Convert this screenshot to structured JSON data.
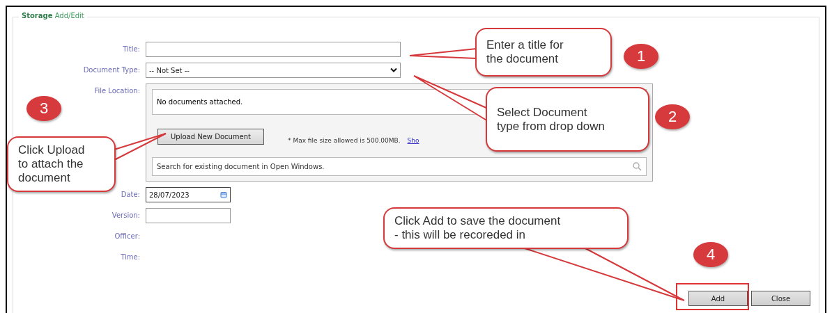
{
  "fieldset": {
    "legend": "**Storage** Add/Edit"
  },
  "fields": [
    {
      "kind": "text",
      "label": "Title:"
    },
    {
      "kind": "select",
      "label": "Document Type:",
      "value": "-- Not Set --"
    },
    {
      "kind": "files",
      "label": "File Location:",
      "empty_message": "No documents attached.",
      "upload_button": "Upload New Document",
      "size_note": "* Max file size allowed is 500.00MB.",
      "link": "Sho",
      "search_placeholder": "Search for existing document in Open Windows."
    },
    {
      "kind": "date",
      "label": "Date:",
      "value": "28/07/2023"
    },
    {
      "kind": "text",
      "label": "Version:"
    },
    {
      "kind": "static",
      "label": "Officer:"
    },
    {
      "kind": "static",
      "label": "Time:"
    }
  ],
  "buttons": [
    {
      "label": "Add",
      "highlighted": true
    },
    {
      "label": "Close",
      "highlighted": false
    }
  ],
  "annotations": [
    {
      "number": "1",
      "lines": [
        "Enter a title for",
        "the document"
      ]
    },
    {
      "number": "3",
      "lines": [
        "Click Upload",
        "to attach the",
        "document"
      ]
    },
    {
      "number": "2",
      "lines": [
        "Select Document",
        "type from drop down"
      ]
    },
    {
      "number": "4",
      "lines": [
        "Click Add to save the document",
        "- this will be recoreded in"
      ]
    }
  ]
}
